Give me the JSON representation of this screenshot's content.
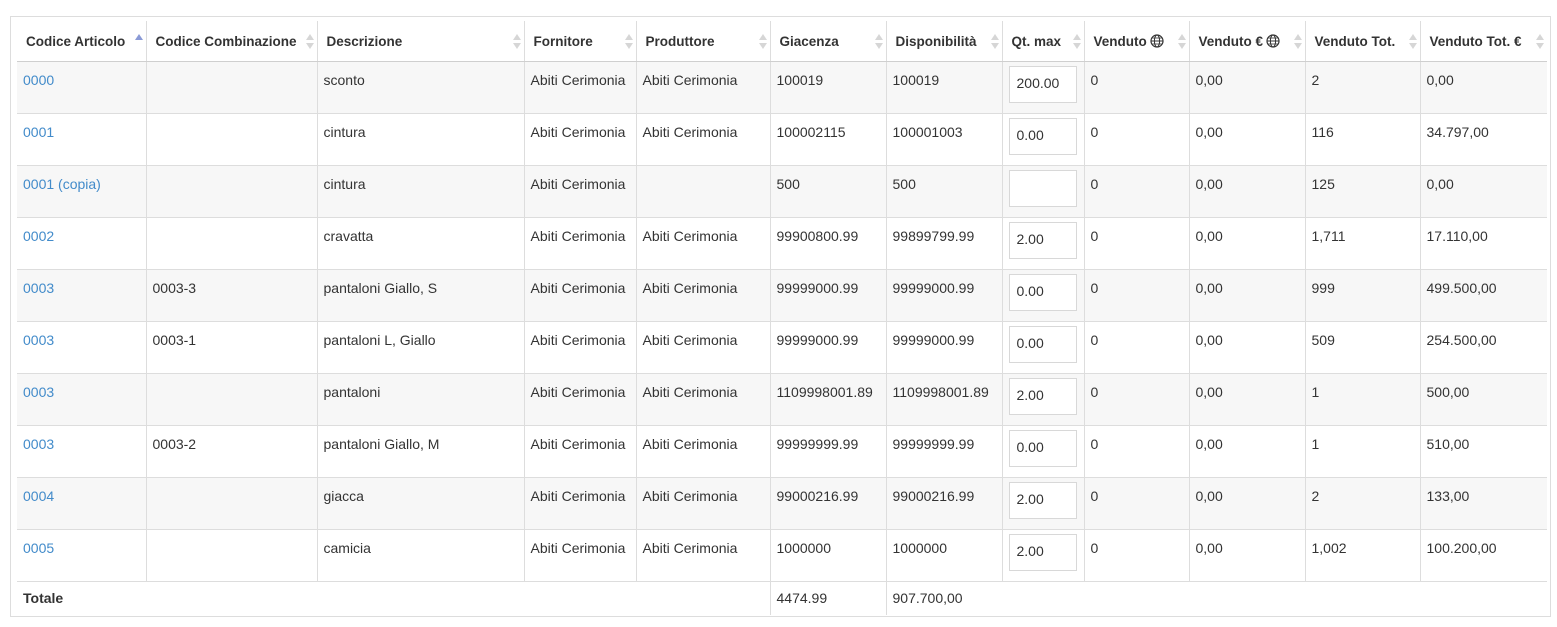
{
  "colors": {
    "link": "#428bca",
    "border": "#dddddd",
    "stripe": "#f7f7f7",
    "sort_active": "#8a9ad6"
  },
  "table": {
    "headers": [
      {
        "label": "Codice Articolo",
        "sort": "asc"
      },
      {
        "label": "Codice Combinazione",
        "sort": "none"
      },
      {
        "label": "Descrizione",
        "sort": "none"
      },
      {
        "label": "Fornitore",
        "sort": "none"
      },
      {
        "label": "Produttore",
        "sort": "none"
      },
      {
        "label": "Giacenza",
        "sort": "none"
      },
      {
        "label": "Disponibilità",
        "sort": "none"
      },
      {
        "label": "Qt. max",
        "sort": "none"
      },
      {
        "label": "Venduto",
        "sort": "none",
        "icon": "globe-icon"
      },
      {
        "label": "Venduto €",
        "sort": "none",
        "icon": "globe-icon"
      },
      {
        "label": "Venduto Tot.",
        "sort": "none"
      },
      {
        "label": "Venduto Tot. €",
        "sort": "none"
      }
    ],
    "rows": [
      {
        "codice": "0000",
        "combinazione": "",
        "descrizione": "sconto",
        "fornitore": "Abiti Cerimonia",
        "produttore": "Abiti Cerimonia",
        "giacenza": "100019",
        "disponibilita": "100019",
        "qt_max": "200.00",
        "venduto": "0",
        "venduto_eur": "0,00",
        "venduto_tot": "2",
        "venduto_tot_eur": "0,00"
      },
      {
        "codice": "0001",
        "combinazione": "",
        "descrizione": "cintura",
        "fornitore": "Abiti Cerimonia",
        "produttore": "Abiti Cerimonia",
        "giacenza": "100002115",
        "disponibilita": "100001003",
        "qt_max": "0.00",
        "venduto": "0",
        "venduto_eur": "0,00",
        "venduto_tot": "116",
        "venduto_tot_eur": "34.797,00"
      },
      {
        "codice": "0001 (copia)",
        "combinazione": "",
        "descrizione": "cintura",
        "fornitore": "Abiti Cerimonia",
        "produttore": "",
        "giacenza": "500",
        "disponibilita": "500",
        "qt_max": "",
        "venduto": "0",
        "venduto_eur": "0,00",
        "venduto_tot": "125",
        "venduto_tot_eur": "0,00"
      },
      {
        "codice": "0002",
        "combinazione": "",
        "descrizione": "cravatta",
        "fornitore": "Abiti Cerimonia",
        "produttore": "Abiti Cerimonia",
        "giacenza": "99900800.99",
        "disponibilita": "99899799.99",
        "qt_max": "2.00",
        "venduto": "0",
        "venduto_eur": "0,00",
        "venduto_tot": "1,711",
        "venduto_tot_eur": "17.110,00"
      },
      {
        "codice": "0003",
        "combinazione": "0003-3",
        "descrizione": "pantaloni Giallo, S",
        "fornitore": "Abiti Cerimonia",
        "produttore": "Abiti Cerimonia",
        "giacenza": "99999000.99",
        "disponibilita": "99999000.99",
        "qt_max": "0.00",
        "venduto": "0",
        "venduto_eur": "0,00",
        "venduto_tot": "999",
        "venduto_tot_eur": "499.500,00"
      },
      {
        "codice": "0003",
        "combinazione": "0003-1",
        "descrizione": "pantaloni L, Giallo",
        "fornitore": "Abiti Cerimonia",
        "produttore": "Abiti Cerimonia",
        "giacenza": "99999000.99",
        "disponibilita": "99999000.99",
        "qt_max": "0.00",
        "venduto": "0",
        "venduto_eur": "0,00",
        "venduto_tot": "509",
        "venduto_tot_eur": "254.500,00"
      },
      {
        "codice": "0003",
        "combinazione": "",
        "descrizione": "pantaloni",
        "fornitore": "Abiti Cerimonia",
        "produttore": "Abiti Cerimonia",
        "giacenza": "1109998001.89",
        "disponibilita": "1109998001.89",
        "qt_max": "2.00",
        "venduto": "0",
        "venduto_eur": "0,00",
        "venduto_tot": "1",
        "venduto_tot_eur": "500,00"
      },
      {
        "codice": "0003",
        "combinazione": "0003-2",
        "descrizione": "pantaloni Giallo, M",
        "fornitore": "Abiti Cerimonia",
        "produttore": "Abiti Cerimonia",
        "giacenza": "99999999.99",
        "disponibilita": "99999999.99",
        "qt_max": "0.00",
        "venduto": "0",
        "venduto_eur": "0,00",
        "venduto_tot": "1",
        "venduto_tot_eur": "510,00"
      },
      {
        "codice": "0004",
        "combinazione": "",
        "descrizione": "giacca",
        "fornitore": "Abiti Cerimonia",
        "produttore": "Abiti Cerimonia",
        "giacenza": "99000216.99",
        "disponibilita": "99000216.99",
        "qt_max": "2.00",
        "venduto": "0",
        "venduto_eur": "0,00",
        "venduto_tot": "2",
        "venduto_tot_eur": "133,00"
      },
      {
        "codice": "0005",
        "combinazione": "",
        "descrizione": "camicia",
        "fornitore": "Abiti Cerimonia",
        "produttore": "Abiti Cerimonia",
        "giacenza": "1000000",
        "disponibilita": "1000000",
        "qt_max": "2.00",
        "venduto": "0",
        "venduto_eur": "0,00",
        "venduto_tot": "1,002",
        "venduto_tot_eur": "100.200,00"
      }
    ],
    "footer": {
      "label": "Totale",
      "giacenza_total": "4474.99",
      "disponibilita_total": "907.700,00"
    }
  }
}
